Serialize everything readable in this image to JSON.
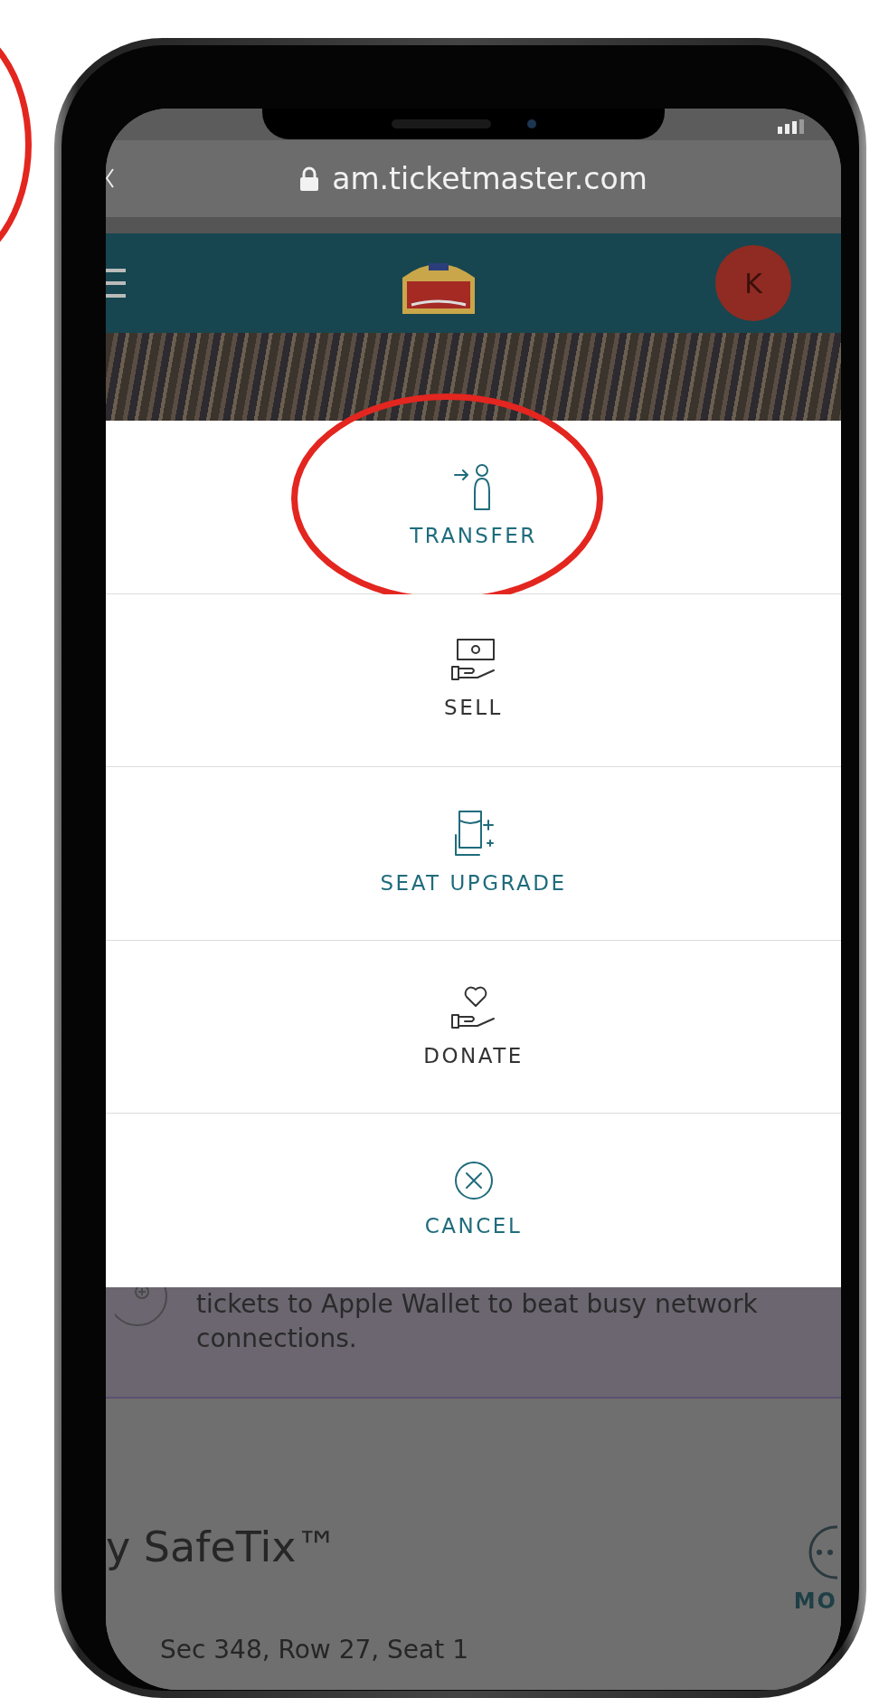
{
  "browser": {
    "url": "am.ticketmaster.com"
  },
  "header": {
    "avatar_initial": "K"
  },
  "action_menu": {
    "items": [
      {
        "kind": "transfer",
        "label": "TRANSFER",
        "color": "#1f6c7c",
        "highlighted": true
      },
      {
        "kind": "sell",
        "label": "SELL",
        "color": "#333333",
        "highlighted": false
      },
      {
        "kind": "upgrade",
        "label": "SEAT UPGRADE",
        "color": "#1f6c7c",
        "highlighted": false
      },
      {
        "kind": "donate",
        "label": "DONATE",
        "color": "#333333",
        "highlighted": false
      },
      {
        "kind": "cancel",
        "label": "CANCEL",
        "color": "#1f6c7c",
        "highlighted": false
      }
    ]
  },
  "page_behind": {
    "wallet_lines": [
      "tickets to Apple Wallet to beat busy network",
      "connections."
    ],
    "title": "y SafeTix™",
    "more_label": "MO",
    "seat": "Sec 348, Row 27, Seat 1"
  }
}
